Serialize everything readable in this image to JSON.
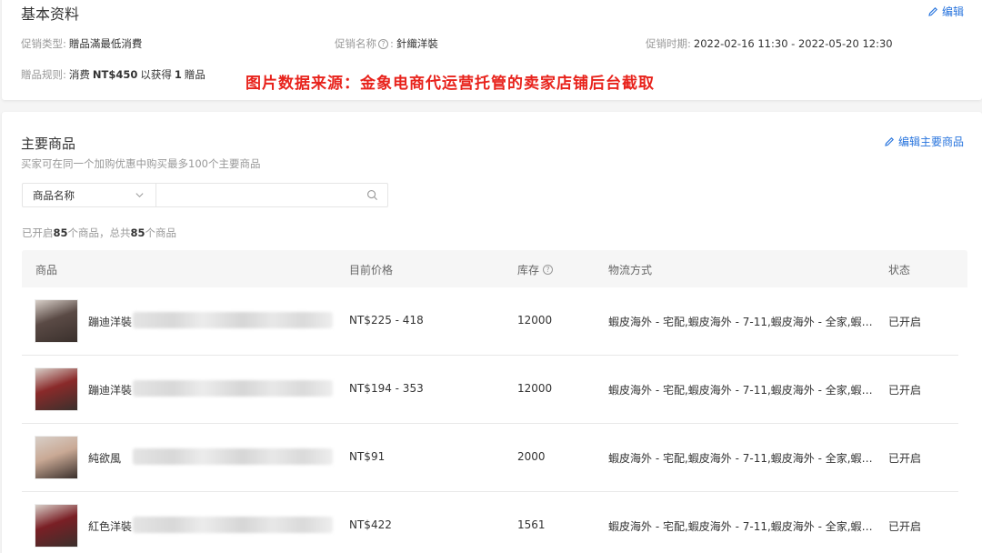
{
  "basic": {
    "title": "基本资料",
    "edit_label": "编辑",
    "promo_type_label": "促销类型:",
    "promo_type_value": "贈品滿最低消費",
    "promo_name_label": "促销名称",
    "promo_name_value": "針織洋裝",
    "promo_period_label": "促销时期:",
    "promo_period_value": "2022-02-16 11:30 - 2022-05-20 12:30",
    "gift_rule_label": "贈品规则:",
    "gift_rule_prefix": "消费",
    "gift_rule_amount": "NT$450",
    "gift_rule_middle": "以获得",
    "gift_rule_qty": "1",
    "gift_rule_suffix": "贈品"
  },
  "watermark": "图片数据来源：金象电商代运营托管的卖家店铺后台截取",
  "main": {
    "title": "主要商品",
    "edit_label": "编辑主要商品",
    "subtitle": "买家可在同一个加购优惠中购买最多100个主要商品",
    "search": {
      "select_value": "商品名称",
      "placeholder": ""
    },
    "count": {
      "prefix": "已开启",
      "enabled": "85",
      "middle": "个商品，总共",
      "total": "85",
      "suffix": "个商品"
    },
    "table": {
      "headers": {
        "product": "商品",
        "price": "目前价格",
        "stock": "库存",
        "logistics": "物流方式",
        "status": "状态"
      },
      "rows": [
        {
          "name": "蹦迪洋裝",
          "price": "NT$225 - 418",
          "stock": "12000",
          "logistics": "蝦皮海外 - 宅配,蝦皮海外 - 7-11,蝦皮海外 - 全家,蝦皮海...",
          "status": "已开启",
          "thumb_color": "#5a4a45"
        },
        {
          "name": "蹦迪洋裝",
          "price": "NT$194 - 353",
          "stock": "12000",
          "logistics": "蝦皮海外 - 宅配,蝦皮海外 - 7-11,蝦皮海外 - 全家,蝦皮海...",
          "status": "已开启",
          "thumb_color": "#8a2a2a"
        },
        {
          "name": "純欲風",
          "price": "NT$91",
          "stock": "2000",
          "logistics": "蝦皮海外 - 宅配,蝦皮海外 - 7-11,蝦皮海外 - 全家,蝦皮海...",
          "status": "已开启",
          "thumb_color": "#c9a995"
        },
        {
          "name": "紅色洋裝",
          "price": "NT$422",
          "stock": "1561",
          "logistics": "蝦皮海外 - 宅配,蝦皮海外 - 7-11,蝦皮海外 - 全家,蝦皮海...",
          "status": "已开启",
          "thumb_color": "#7a1f25"
        }
      ]
    }
  },
  "colors": {
    "link": "#2673dd",
    "watermark": "#e8231c"
  }
}
